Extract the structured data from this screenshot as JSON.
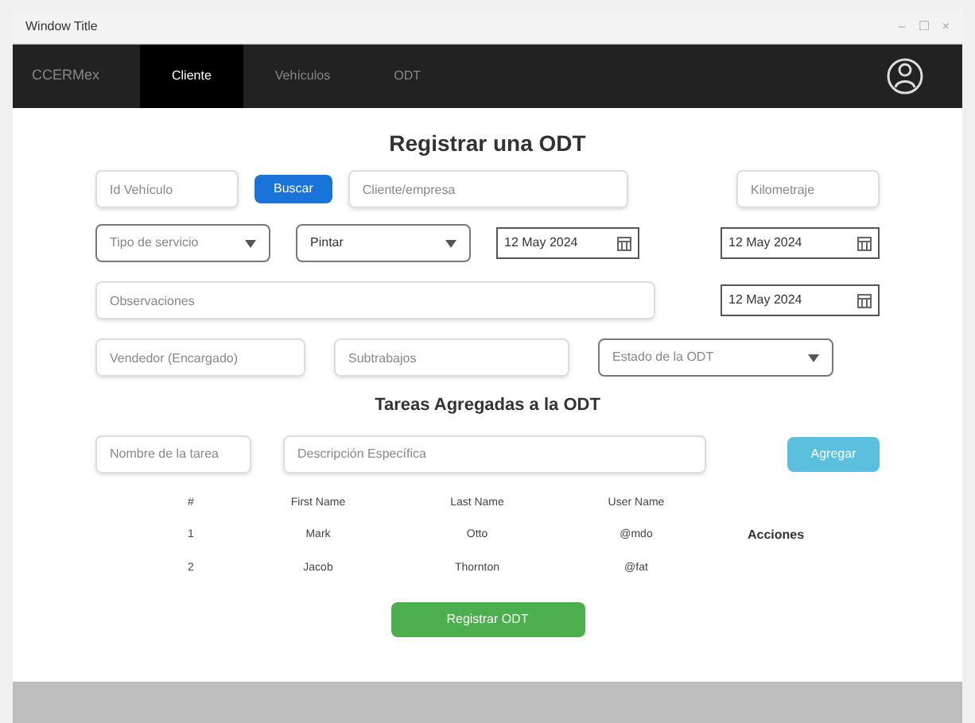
{
  "window": {
    "title": "Window Title",
    "controls": [
      "–",
      "☐",
      "×"
    ]
  },
  "navbar": {
    "brand": "CCERMex",
    "tabs": [
      {
        "label": "Cliente",
        "selected": true
      },
      {
        "label": "Vehículos",
        "selected": false
      },
      {
        "label": "ODT",
        "selected": false
      }
    ]
  },
  "title": "Registrar una ODT",
  "form": {
    "vehicle_id": {
      "placeholder": "Id Vehículo"
    },
    "search_button": "Buscar",
    "client": {
      "placeholder": "Cliente/empresa"
    },
    "mileage": {
      "placeholder": "Kilometraje"
    },
    "service_type": {
      "placeholder": "Tipo de servicio"
    },
    "option": {
      "value": "Pintar"
    },
    "date_1": {
      "value": "12 May 2024"
    },
    "date_2": {
      "value": "12 May 2024"
    },
    "notes": {
      "placeholder": "Observaciones"
    },
    "date_3": {
      "value": "12 May 2024"
    },
    "seller": {
      "placeholder": "Vendedor (Encargado)"
    },
    "tasks_field": {
      "placeholder": "Subtrabajos"
    },
    "status": {
      "placeholder": "Estado de la ODT"
    }
  },
  "tasks_title": "Tareas Agregadas a la ODT",
  "task_form": {
    "name": {
      "placeholder": "Nombre de la tarea"
    },
    "description": {
      "placeholder": "Descripción Específica"
    },
    "add_button": "Agregar"
  },
  "table": {
    "columns": [
      "#",
      "First Name",
      "Last Name",
      "User Name"
    ],
    "rows": [
      [
        "1",
        "Mark",
        "Otto",
        "@mdo"
      ],
      [
        "2",
        "Jacob",
        "Thornton",
        "@fat"
      ]
    ],
    "actions": "Acciones"
  },
  "submit_button": "Registrar ODT"
}
